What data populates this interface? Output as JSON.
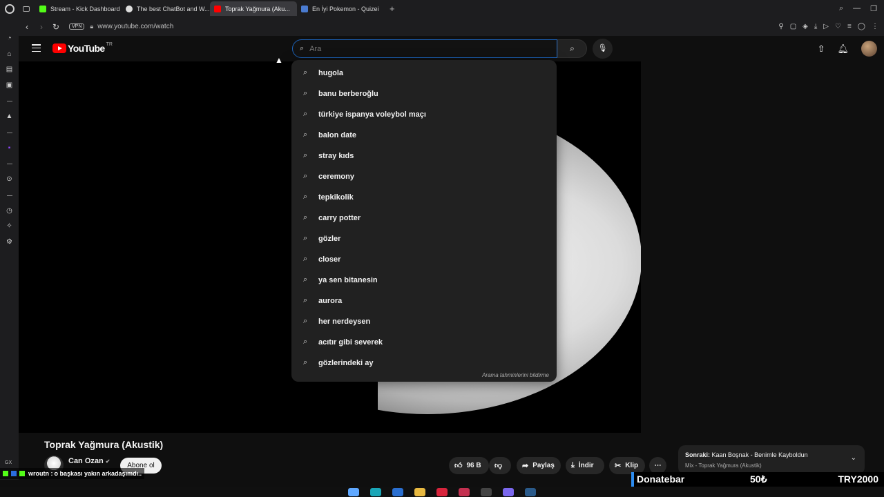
{
  "browser": {
    "tabs": [
      {
        "label": "Stream - Kick Dashboard",
        "fav_color": "#53fc18",
        "active": false
      },
      {
        "label": "The best ChatBot and W...",
        "fav_color": "#dddddd",
        "active": false
      },
      {
        "label": "Toprak Yağmura (Aku...",
        "fav_color": "#ff0000",
        "active": true
      },
      {
        "label": "En İyi Pokemon - Quizei",
        "fav_color": "#4a7bd0",
        "active": false
      }
    ],
    "vpn_label": "VPN",
    "url": "www.youtube.com/watch"
  },
  "youtube": {
    "logo_text": "YouTube",
    "country": "TR",
    "search_placeholder": "Ara",
    "suggestions": [
      "hugola",
      "banu berberoğlu",
      "türkiye ispanya voleybol maçı",
      "balon date",
      "stray kıds",
      "ceremony",
      "tepkikolik",
      "carry potter",
      "gözler",
      "closer",
      "ya sen bitanesin",
      "aurora",
      "her nerdeysen",
      "acıtır gibi severek",
      "gözlerindeki ay"
    ],
    "suggest_footer": "Arama tahminlerini bildirme",
    "video": {
      "title": "Toprak Yağmura (Akustik)",
      "channel": "Can Ozan",
      "subscribe_label": "Abone ol",
      "likes": "96 B",
      "share_label": "Paylaş",
      "download_label": "İndir",
      "clip_label": "Klip"
    },
    "next_up": {
      "prefix": "Sonraki:",
      "title": "Kaan Boşnak - Benimle Kayboldun",
      "mix": "Mix - Toprak Yağmura (Akustik)"
    }
  },
  "overlay": {
    "gx_label": "GX",
    "chat_user": "wroutn :",
    "chat_message": "o başkası yakın arkadaşımdı..",
    "donate_label": "Donatebar",
    "donate_amount": "50₺",
    "donate_goal": "TRY2000"
  }
}
